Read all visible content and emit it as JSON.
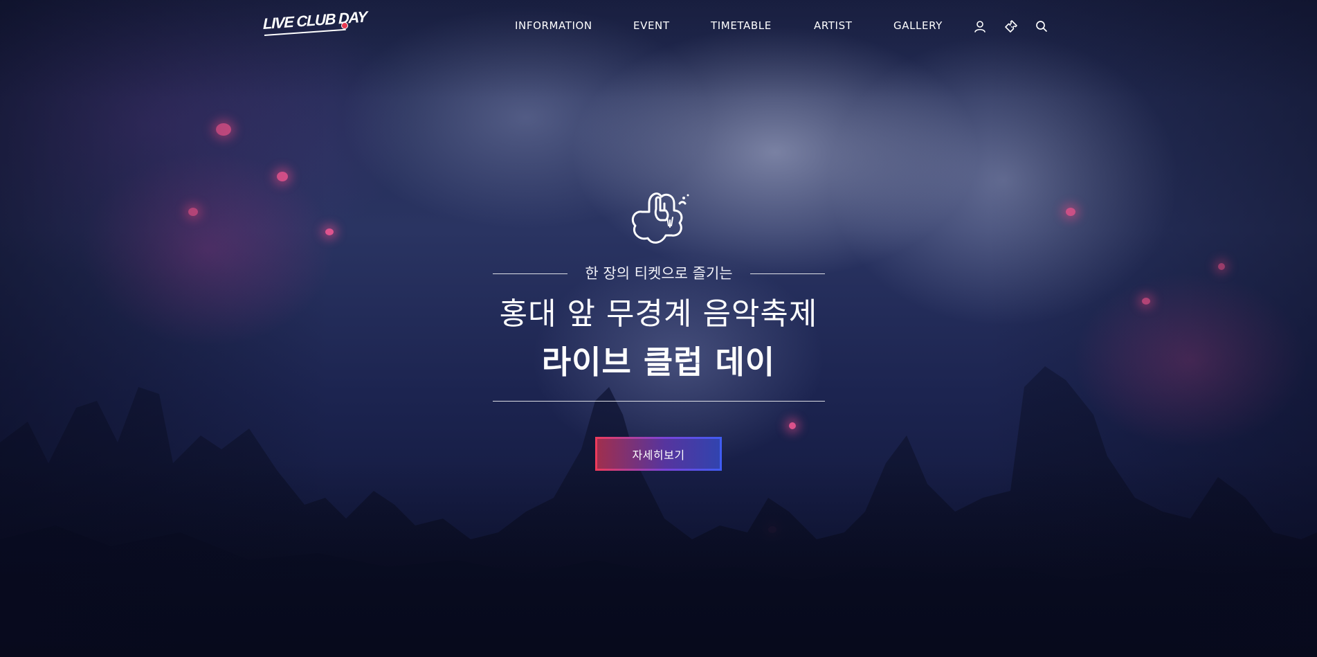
{
  "header": {
    "logo_text": "LIVE CLUB DAY",
    "nav": [
      {
        "label": "INFORMATION"
      },
      {
        "label": "EVENT"
      },
      {
        "label": "TIMETABLE"
      },
      {
        "label": "ARTIST"
      },
      {
        "label": "GALLERY"
      }
    ],
    "icons": [
      "user-icon",
      "ticket-icon",
      "search-icon"
    ]
  },
  "hero": {
    "emblem": "rock-hand-emblem-icon",
    "tagline": "한 장의 티켓으로 즐기는",
    "headline_line1": "홍대 앞 무경계 음악축제",
    "headline_line2": "라이브 클럽 데이",
    "cta_label": "자세히보기"
  },
  "colors": {
    "cta_gradient_start": "#ef3b5a",
    "cta_gradient_end": "#3f5cf2",
    "text": "#ffffff"
  }
}
